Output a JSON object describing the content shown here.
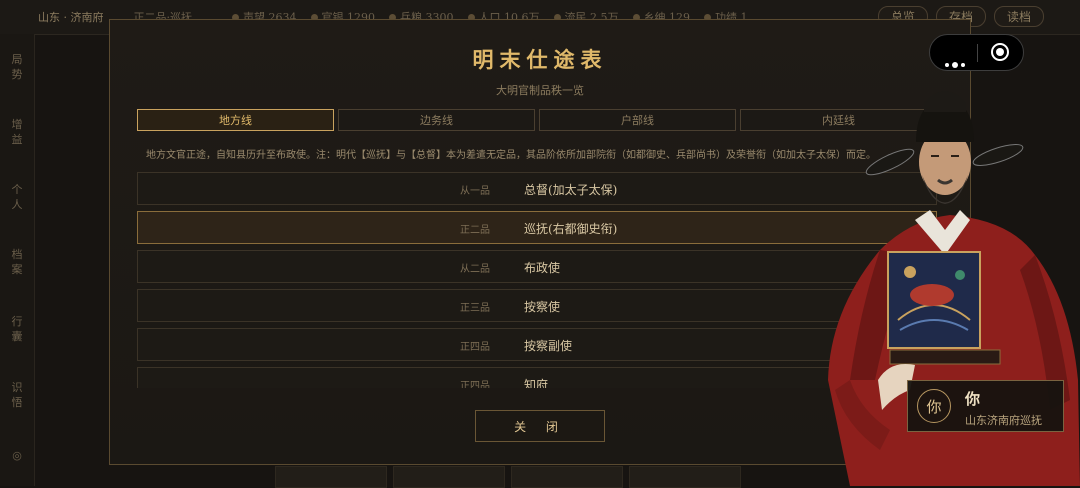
{
  "topbar": {
    "location": "山东 · 济南府",
    "rank": "正二品·巡抚",
    "stats": [
      {
        "icon": "prestige-icon",
        "label": "声望 2634"
      },
      {
        "icon": "silver-icon",
        "label": "官银 1290"
      },
      {
        "icon": "grain-icon",
        "label": "兵粮 3300"
      },
      {
        "icon": "population-icon",
        "label": "人口 10.6万"
      },
      {
        "icon": "tax-icon",
        "label": "流民 2.5万"
      },
      {
        "icon": "gentry-icon",
        "label": "乡绅 129"
      },
      {
        "icon": "merit-icon",
        "label": "功绩 1"
      }
    ],
    "buttons": [
      "总览",
      "存档",
      "读档"
    ]
  },
  "sidenav": {
    "items": [
      "局势",
      "增益",
      "个人",
      "档案",
      "行囊",
      "识悟"
    ],
    "bottom_icon": "settings-icon"
  },
  "modal": {
    "title": "明末仕途表",
    "subtitle": "大明官制品秩一览",
    "tabs": [
      {
        "label": "地方线",
        "active": true
      },
      {
        "label": "边务线",
        "active": false
      },
      {
        "label": "户部线",
        "active": false
      },
      {
        "label": "内廷线",
        "active": false
      }
    ],
    "description": "地方文官正途，自知县历升至布政使。注：明代【巡抚】与【总督】本为差遣无定品，其品阶依所加部院衔（如都御史、兵部尚书）及荣誉衔（如加太子太保）而定。",
    "ranks": [
      {
        "grade": "从一品",
        "title": "总督(加太子太保)",
        "current": false
      },
      {
        "grade": "正二品",
        "title": "巡抚(右都御史衔)",
        "current": true
      },
      {
        "grade": "从二品",
        "title": "布政使",
        "current": false
      },
      {
        "grade": "正三品",
        "title": "按察使",
        "current": false
      },
      {
        "grade": "正四品",
        "title": "按察副使",
        "current": false
      },
      {
        "grade": "正四品",
        "title": "知府",
        "current": false
      }
    ],
    "close_label": "关 闭"
  },
  "capsule": {
    "more_icon": "more-dots-icon",
    "close_icon": "target-circle-icon"
  },
  "player": {
    "avatar_text": "你",
    "name": "你",
    "title": "山东济南府巡抚"
  },
  "colors": {
    "accent": "#e0b96a",
    "panel": "#1f1b16",
    "border": "#5a4a30",
    "robe": "#8e1f1c"
  }
}
